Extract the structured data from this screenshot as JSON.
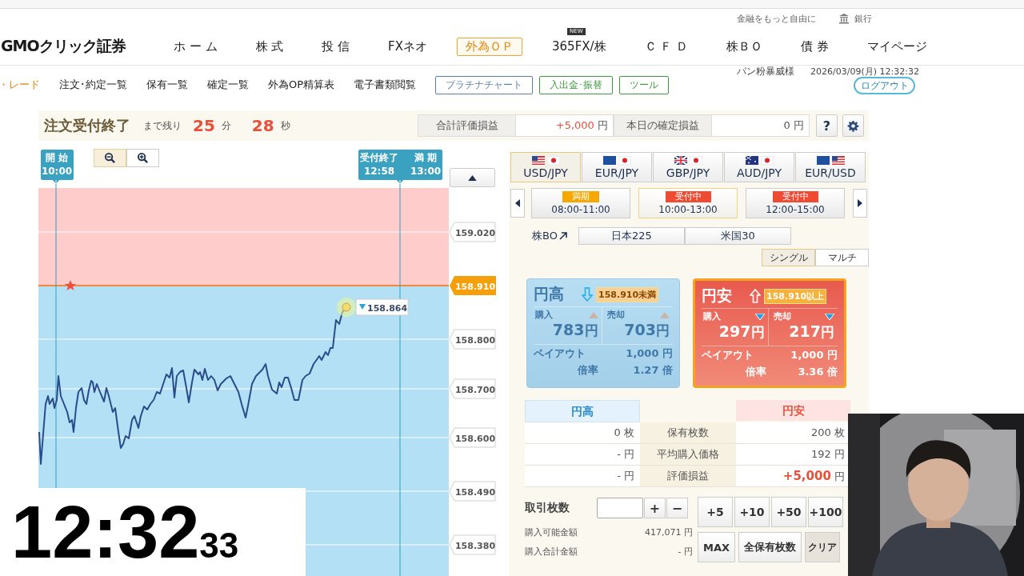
{
  "utility_bar": {
    "tagline": "金融をもっと自由に",
    "bank_link": "銀行"
  },
  "logo": "GMOクリック証券",
  "nav": [
    {
      "label": "ホ ー ム",
      "selected": false
    },
    {
      "label": "株 式",
      "selected": false
    },
    {
      "label": "投 信",
      "selected": false
    },
    {
      "label": "FXネオ",
      "selected": false
    },
    {
      "label": "外為ＯＰ",
      "selected": true
    },
    {
      "label": "365FX/株",
      "selected": false,
      "badge": "NEW"
    },
    {
      "label": "Ｃ Ｆ Ｄ",
      "selected": false
    },
    {
      "label": "株ＢＯ",
      "selected": false
    },
    {
      "label": "債 券",
      "selected": false
    },
    {
      "label": "マイページ",
      "selected": false
    }
  ],
  "subnav": {
    "links": [
      {
        "label": "・レード",
        "selected": true
      },
      {
        "label": "注文･約定一覧",
        "selected": false
      },
      {
        "label": "保有一覧",
        "selected": false
      },
      {
        "label": "確定一覧",
        "selected": false
      },
      {
        "label": "外為OP精算表",
        "selected": false
      },
      {
        "label": "電子書類閲覧",
        "selected": false
      }
    ],
    "buttons": [
      {
        "label": "プラチナチャート",
        "color": "#5a7fa8"
      },
      {
        "label": "入出金･振替",
        "color": "#3f9a3f"
      },
      {
        "label": "ツール",
        "color": "#3f9a3f"
      }
    ]
  },
  "user": {
    "name": "パン粉暴威様",
    "datetime": "2026/03/09(月) 12:32:32",
    "logout": "ログアウト"
  },
  "order_status": {
    "title": "注文受付終了",
    "remaining_label": "まで残り",
    "minutes": "25",
    "minutes_unit": "分",
    "seconds": "28",
    "seconds_unit": "秒"
  },
  "summary": [
    {
      "label": "合計評価損益",
      "value": "+5,000",
      "unit": "円",
      "positive": true
    },
    {
      "label": "本日の確定損益",
      "value": "0",
      "unit": "円",
      "positive": false
    }
  ],
  "help_button": "?",
  "chart": {
    "start_marker": {
      "label": "開 始",
      "time": "10:00"
    },
    "end_markers": [
      {
        "label": "受付終了",
        "time": "12:58"
      },
      {
        "label": "満 期",
        "time": "13:00"
      }
    ],
    "target_price": "158.910",
    "price_labels": [
      "159.020",
      "158.800",
      "158.700",
      "158.600",
      "158.490",
      "158.380"
    ],
    "current_price": "158.864"
  },
  "pair_tabs": [
    {
      "label": "USD/JPY",
      "selected": true
    },
    {
      "label": "EUR/JPY",
      "selected": false
    },
    {
      "label": "GBP/JPY",
      "selected": false
    },
    {
      "label": "AUD/JPY",
      "selected": false
    },
    {
      "label": "EUR/USD",
      "selected": false
    }
  ],
  "sessions": [
    {
      "status": "満期",
      "kind": "closed",
      "time": "08:00-11:00",
      "selected": false
    },
    {
      "status": "受付中",
      "kind": "open",
      "time": "10:00-13:00",
      "selected": true
    },
    {
      "status": "受付中",
      "kind": "open",
      "time": "12:00-15:00",
      "selected": false
    }
  ],
  "stock_bo": {
    "label": "株BO",
    "buttons": [
      "日本225",
      "米国30"
    ]
  },
  "view_toggle": [
    {
      "label": "シングル",
      "selected": true
    },
    {
      "label": "マルチ",
      "selected": false
    }
  ],
  "options": [
    {
      "title": "円高",
      "kind": "down",
      "threshold": "158.910未満",
      "buy_label": "購入",
      "buy_price": "783",
      "buy_unit": "円",
      "sell_label": "売却",
      "sell_price": "703",
      "sell_unit": "円",
      "payout_label": "ペイアウト",
      "payout": "1,000",
      "payout_unit": "円",
      "ratio_label": "倍率",
      "ratio": "1.27",
      "ratio_unit": "倍",
      "disabled": true,
      "selected": false
    },
    {
      "title": "円安",
      "kind": "up",
      "threshold": "158.910以上",
      "buy_label": "購入",
      "buy_price": "297",
      "buy_unit": "円",
      "sell_label": "売却",
      "sell_price": "217",
      "sell_unit": "円",
      "payout_label": "ペイアウト",
      "payout": "1,000",
      "payout_unit": "円",
      "ratio_label": "倍率",
      "ratio": "3.36",
      "ratio_unit": "倍",
      "disabled": false,
      "selected": true
    }
  ],
  "positions": {
    "headers": [
      "円高",
      "円安"
    ],
    "rows": [
      {
        "label": "保有枚数",
        "high": {
          "value": "0",
          "unit": "枚",
          "positive": false
        },
        "low": {
          "value": "200",
          "unit": "枚",
          "positive": false
        }
      },
      {
        "label": "平均購入価格",
        "high": {
          "value": "-",
          "unit": "円",
          "positive": false
        },
        "low": {
          "value": "192",
          "unit": "円",
          "positive": false
        }
      },
      {
        "label": "評価損益",
        "high": {
          "value": "-",
          "unit": "円",
          "positive": false
        },
        "low": {
          "value": "+5,000",
          "unit": "円",
          "positive": true
        }
      }
    ]
  },
  "trade": {
    "quantity_label": "取引枚数",
    "step_buttons": [
      "+",
      "−"
    ],
    "quick_add": [
      "+5",
      "+10",
      "+50",
      "+100"
    ],
    "available_label": "購入可能金額",
    "available": "417,071 円",
    "total_label": "購入合計金額",
    "total": "- 円",
    "actions": [
      "MAX",
      "全保有枚数",
      "クリア"
    ]
  },
  "clock_overlay": {
    "time": "12:32",
    "seconds": "33"
  }
}
